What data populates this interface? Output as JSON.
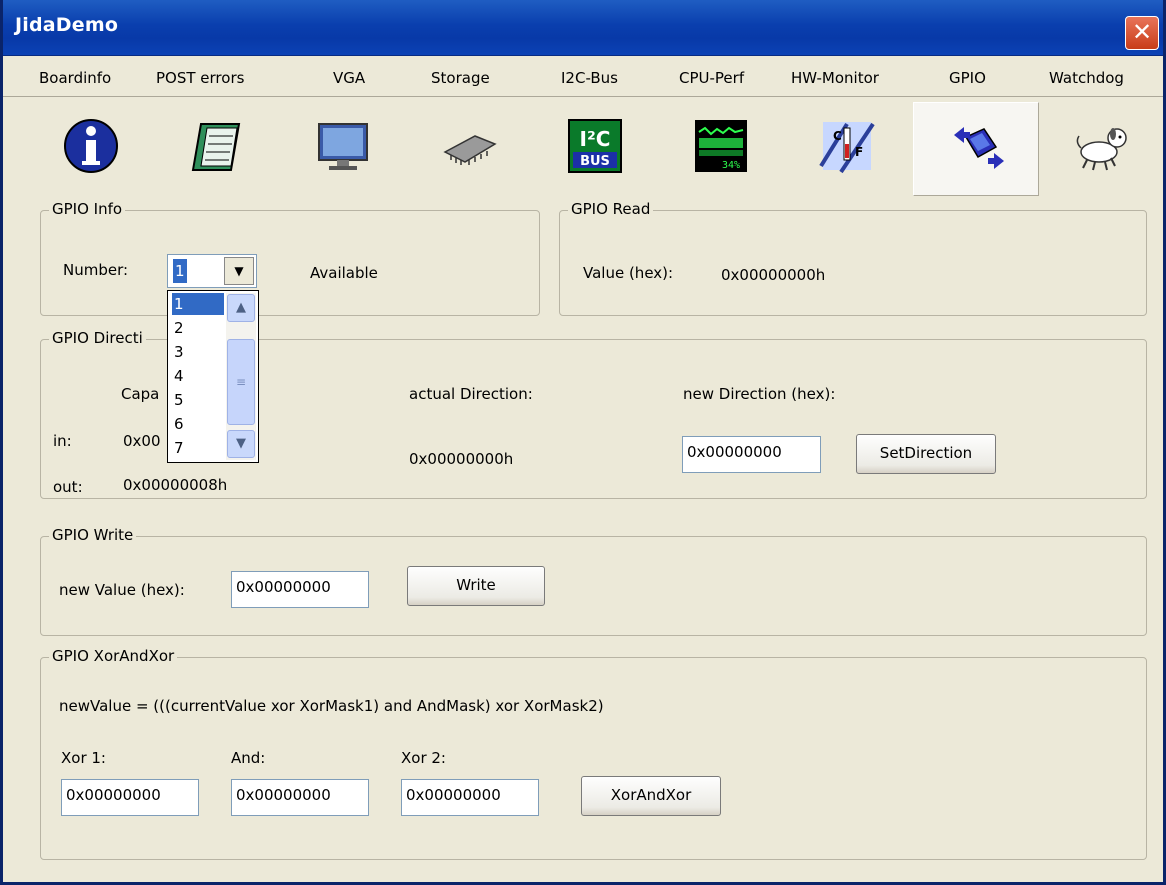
{
  "window": {
    "title": "JidaDemo"
  },
  "tabs": [
    "Boardinfo",
    "POST errors",
    "VGA",
    "Storage",
    "I2C-Bus",
    "CPU-Perf",
    "HW-Monitor",
    "GPIO",
    "Watchdog"
  ],
  "icons": [
    "info-icon",
    "notebook-icon",
    "monitor-icon",
    "chip-icon",
    "i2c-bus-icon",
    "cpu-perf-icon",
    "hw-monitor-icon",
    "gpio-icon",
    "watchdog-icon"
  ],
  "icon_texts": {
    "i2c_top": "I²C",
    "i2c_bottom": "BUS",
    "cpu_percent": "34%",
    "hw_c": "C",
    "hw_f": "F"
  },
  "gpio_info": {
    "title": "GPIO Info",
    "number_label": "Number:",
    "number_value": "1",
    "status": "Available",
    "dropdown_arrow": "▼",
    "options": [
      "1",
      "2",
      "3",
      "4",
      "5",
      "6",
      "7"
    ],
    "scroll_up": "▲",
    "scroll_down": "▼",
    "scroll_grip": "≡"
  },
  "gpio_read": {
    "title": "GPIO Read",
    "value_label": "Value (hex):",
    "value": "0x00000000h"
  },
  "gpio_direction": {
    "title": "GPIO Directi",
    "capa_label": "Capa",
    "in_label": "in:",
    "in_value": "0x00",
    "out_label": "out:",
    "out_value": "0x00000008h",
    "actual_label": "actual Direction:",
    "actual_value": "0x00000000h",
    "new_label": "new Direction (hex):",
    "new_value": "0x00000000",
    "button": "SetDirection"
  },
  "gpio_write": {
    "title": "GPIO Write",
    "label": "new Value (hex):",
    "value": "0x00000000",
    "button": "Write"
  },
  "gpio_xor": {
    "title": "GPIO XorAndXor",
    "formula": "newValue = (((currentValue xor XorMask1) and AndMask) xor XorMask2)",
    "xor1_label": "Xor 1:",
    "xor1_value": "0x00000000",
    "and_label": "And:",
    "and_value": "0x00000000",
    "xor2_label": "Xor 2:",
    "xor2_value": "0x00000000",
    "button": "XorAndXor"
  },
  "colors": {
    "title_bar": "#0a3fae",
    "selection": "#316ac5",
    "close": "#d8532c"
  }
}
